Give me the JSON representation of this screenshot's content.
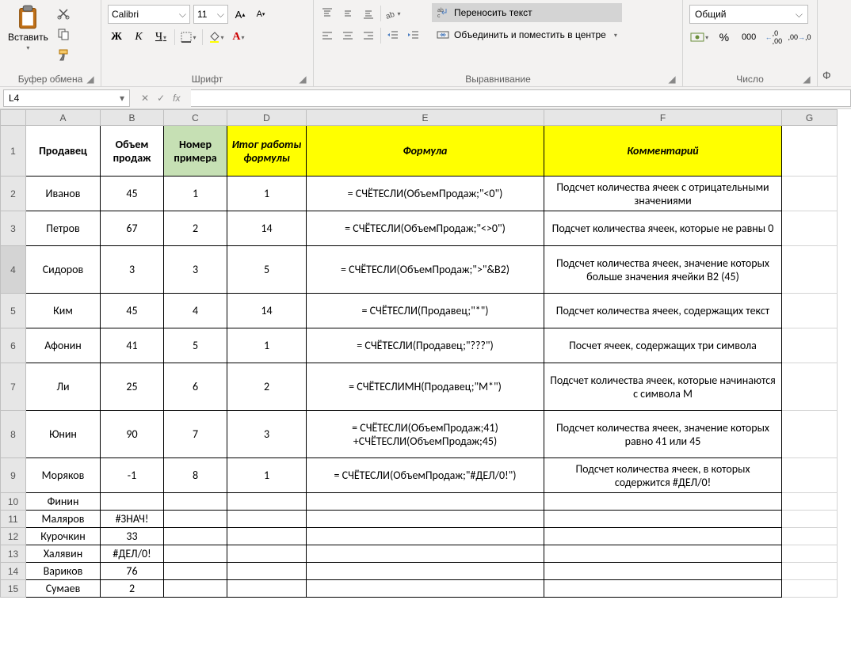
{
  "ribbon": {
    "clipboard": {
      "label": "Буфер обмена",
      "paste": "Вставить"
    },
    "font": {
      "label": "Шрифт",
      "name": "Calibri",
      "size": "11"
    },
    "alignment": {
      "label": "Выравнивание",
      "wrap": "Переносить текст",
      "merge": "Объединить и поместить в центре"
    },
    "number": {
      "label": "Число",
      "format": "Общий"
    }
  },
  "formula_bar": {
    "cell_ref": "L4",
    "fx": "fx"
  },
  "cols": [
    "A",
    "B",
    "C",
    "D",
    "E",
    "F",
    "G"
  ],
  "headers": {
    "a": "Продавец",
    "b": "Объем продаж",
    "c": "Номер примера",
    "d": "Итог работы формулы",
    "e": "Формула",
    "f": "Комментарий"
  },
  "rows": [
    {
      "n": 2,
      "a": "Иванов",
      "b": "45",
      "c": "1",
      "d": "1",
      "e": "= СЧЁТЕСЛИ(ОбъемПродаж;\"<0\")",
      "f": "Подсчет количества ячеек с отрицательными значениями"
    },
    {
      "n": 3,
      "a": "Петров",
      "b": "67",
      "c": "2",
      "d": "14",
      "e": "= СЧЁТЕСЛИ(ОбъемПродаж;\"<>0\")",
      "f": "Подсчет количества ячеек, которые не равны 0"
    },
    {
      "n": 4,
      "a": "Сидоров",
      "b": "3",
      "c": "3",
      "d": "5",
      "e": "= СЧЁТЕСЛИ(ОбъемПродаж;\">\"&B2)",
      "f": "Подсчет количества ячеек, значение которых больше значения ячейки B2 (45)"
    },
    {
      "n": 5,
      "a": "Ким",
      "b": "45",
      "c": "4",
      "d": "14",
      "e": "= СЧЁТЕСЛИ(Продавец;\"*\")",
      "f": "Подсчет количества ячеек, содержащих текст"
    },
    {
      "n": 6,
      "a": "Афонин",
      "b": "41",
      "c": "5",
      "d": "1",
      "e": "= СЧЁТЕСЛИ(Продавец;\"???\")",
      "f": "Посчет ячеек, содержащих три символа"
    },
    {
      "n": 7,
      "a": "Ли",
      "b": "25",
      "c": "6",
      "d": "2",
      "e": "= СЧЁТЕСЛИМН(Продавец;\"М*\")",
      "f": "Подсчет количества ячеек, которые начинаются с символа М"
    },
    {
      "n": 8,
      "a": "Юнин",
      "b": "90",
      "c": "7",
      "d": "3",
      "e": "= СЧЁТЕСЛИ(ОбъемПродаж;41) +СЧЁТЕСЛИ(ОбъемПродаж;45)",
      "f": "Подсчет количества ячеек, значение которых равно 41 или 45"
    },
    {
      "n": 9,
      "a": "Моряков",
      "b": "-1",
      "c": "8",
      "d": "1",
      "e": "= СЧЁТЕСЛИ(ОбъемПродаж;\"#ДЕЛ/0!\")",
      "f": "Подсчет количества ячеек, в которых содержится #ДЕЛ/0!"
    },
    {
      "n": 10,
      "a": "Финин",
      "b": "",
      "c": "",
      "d": "",
      "e": "",
      "f": ""
    },
    {
      "n": 11,
      "a": "Маляров",
      "b": "#ЗНАЧ!",
      "c": "",
      "d": "",
      "e": "",
      "f": ""
    },
    {
      "n": 12,
      "a": "Курочкин",
      "b": "33",
      "c": "",
      "d": "",
      "e": "",
      "f": ""
    },
    {
      "n": 13,
      "a": "Халявин",
      "b": "#ДЕЛ/0!",
      "c": "",
      "d": "",
      "e": "",
      "f": ""
    },
    {
      "n": 14,
      "a": "Вариков",
      "b": "76",
      "c": "",
      "d": "",
      "e": "",
      "f": ""
    },
    {
      "n": 15,
      "a": "Сумаев",
      "b": "2",
      "c": "",
      "d": "",
      "e": "",
      "f": ""
    }
  ]
}
